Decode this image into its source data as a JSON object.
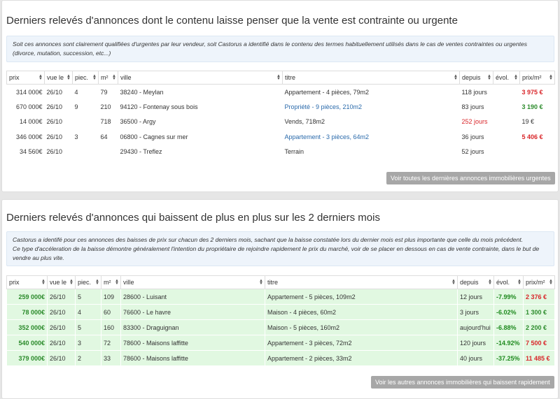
{
  "panel1": {
    "title": "Derniers relevés d'annonces dont le contenu laisse penser que la vente est contrainte ou urgente",
    "info": "Soit ces annonces sont clairement qualifiées d'urgentes par leur vendeur, soit Castorus a identifié dans le contenu des termes habituellement utilisés dans le cas de ventes contraintes ou urgentes (divorce, mutation, succession, etc...)",
    "headers": [
      "prix",
      "vue le",
      "piec.",
      "m²",
      "ville",
      "titre",
      "depuis",
      "évol.",
      "prix/m²"
    ],
    "rows": [
      {
        "prix": "314 000€",
        "vue": "26/10",
        "piec": "4",
        "m2": "79",
        "ville": "38240 - Meylan",
        "titre": "Appartement - 4 pièces, 79m2",
        "depuis": "118 jours",
        "evol": "",
        "pm2": "3 975 €"
      },
      {
        "prix": "670 000€",
        "vue": "26/10",
        "piec": "9",
        "m2": "210",
        "ville": "94120 - Fontenay sous bois",
        "titre": "Propriété - 9 pièces, 210m2",
        "depuis": "83 jours",
        "evol": "",
        "pm2": "3 190 €"
      },
      {
        "prix": "14 000€",
        "vue": "26/10",
        "piec": "",
        "m2": "718",
        "ville": "36500 - Argy",
        "titre": "Vends, 718m2",
        "depuis": "252 jours",
        "evol": "",
        "pm2": "19 €"
      },
      {
        "prix": "346 000€",
        "vue": "26/10",
        "piec": "3",
        "m2": "64",
        "ville": "06800 - Cagnes sur mer",
        "titre": "Appartement - 3 pièces, 64m2",
        "depuis": "36 jours",
        "evol": "",
        "pm2": "5 406 €"
      },
      {
        "prix": "34 560€",
        "vue": "26/10",
        "piec": "",
        "m2": "",
        "ville": "29430 - Treflez",
        "titre": "Terrain",
        "depuis": "52 jours",
        "evol": "",
        "pm2": ""
      }
    ],
    "button": "Voir toutes les dernières annonces immobilières urgentes"
  },
  "panel2": {
    "title": "Derniers relevés d'annonces qui baissent de plus en plus sur les 2 derniers mois",
    "info_line1": "Castorus a identifé pour ces annonces des baisses de prix sur chacun des 2 derniers mois, sachant que la baisse constatée lors du dernier mois est plus importante que celle du mois précédent.",
    "info_line2": "Ce type d'accéleration de la baisse démontre généralement l'intention du propriétaire de rejoindre rapidement le prix du marché, voir de se placer en dessous en cas de vente contrainte, dans le but de vendre au plus vite.",
    "headers": [
      "prix",
      "vue le",
      "piec.",
      "m²",
      "ville",
      "titre",
      "depuis",
      "évol.",
      "prix/m²"
    ],
    "rows": [
      {
        "prix": "259 000€",
        "vue": "26/10",
        "piec": "5",
        "m2": "109",
        "ville": "28600 - Luisant",
        "titre": "Appartement - 5 pièces, 109m2",
        "depuis": "12 jours",
        "evol": "-7.99%",
        "pm2": "2 376 €"
      },
      {
        "prix": "78 000€",
        "vue": "26/10",
        "piec": "4",
        "m2": "60",
        "ville": "76600 - Le havre",
        "titre": "Maison - 4 pièces, 60m2",
        "depuis": "3 jours",
        "evol": "-6.02%",
        "pm2": "1 300 €"
      },
      {
        "prix": "352 000€",
        "vue": "26/10",
        "piec": "5",
        "m2": "160",
        "ville": "83300 - Draguignan",
        "titre": "Maison - 5 pièces, 160m2",
        "depuis": "aujourd'hui",
        "evol": "-6.88%",
        "pm2": "2 200 €"
      },
      {
        "prix": "540 000€",
        "vue": "26/10",
        "piec": "3",
        "m2": "72",
        "ville": "78600 - Maisons laffitte",
        "titre": "Appartement - 3 pièces, 72m2",
        "depuis": "120 jours",
        "evol": "-14.92%",
        "pm2": "7 500 €"
      },
      {
        "prix": "379 000€",
        "vue": "26/10",
        "piec": "2",
        "m2": "33",
        "ville": "78600 - Maisons laffitte",
        "titre": "Appartement - 2 pièces, 33m2",
        "depuis": "40 jours",
        "evol": "-37.25%",
        "pm2": "11 485 €"
      }
    ],
    "button": "Voir les autres annonces immobilières qui baissent rapidement"
  }
}
